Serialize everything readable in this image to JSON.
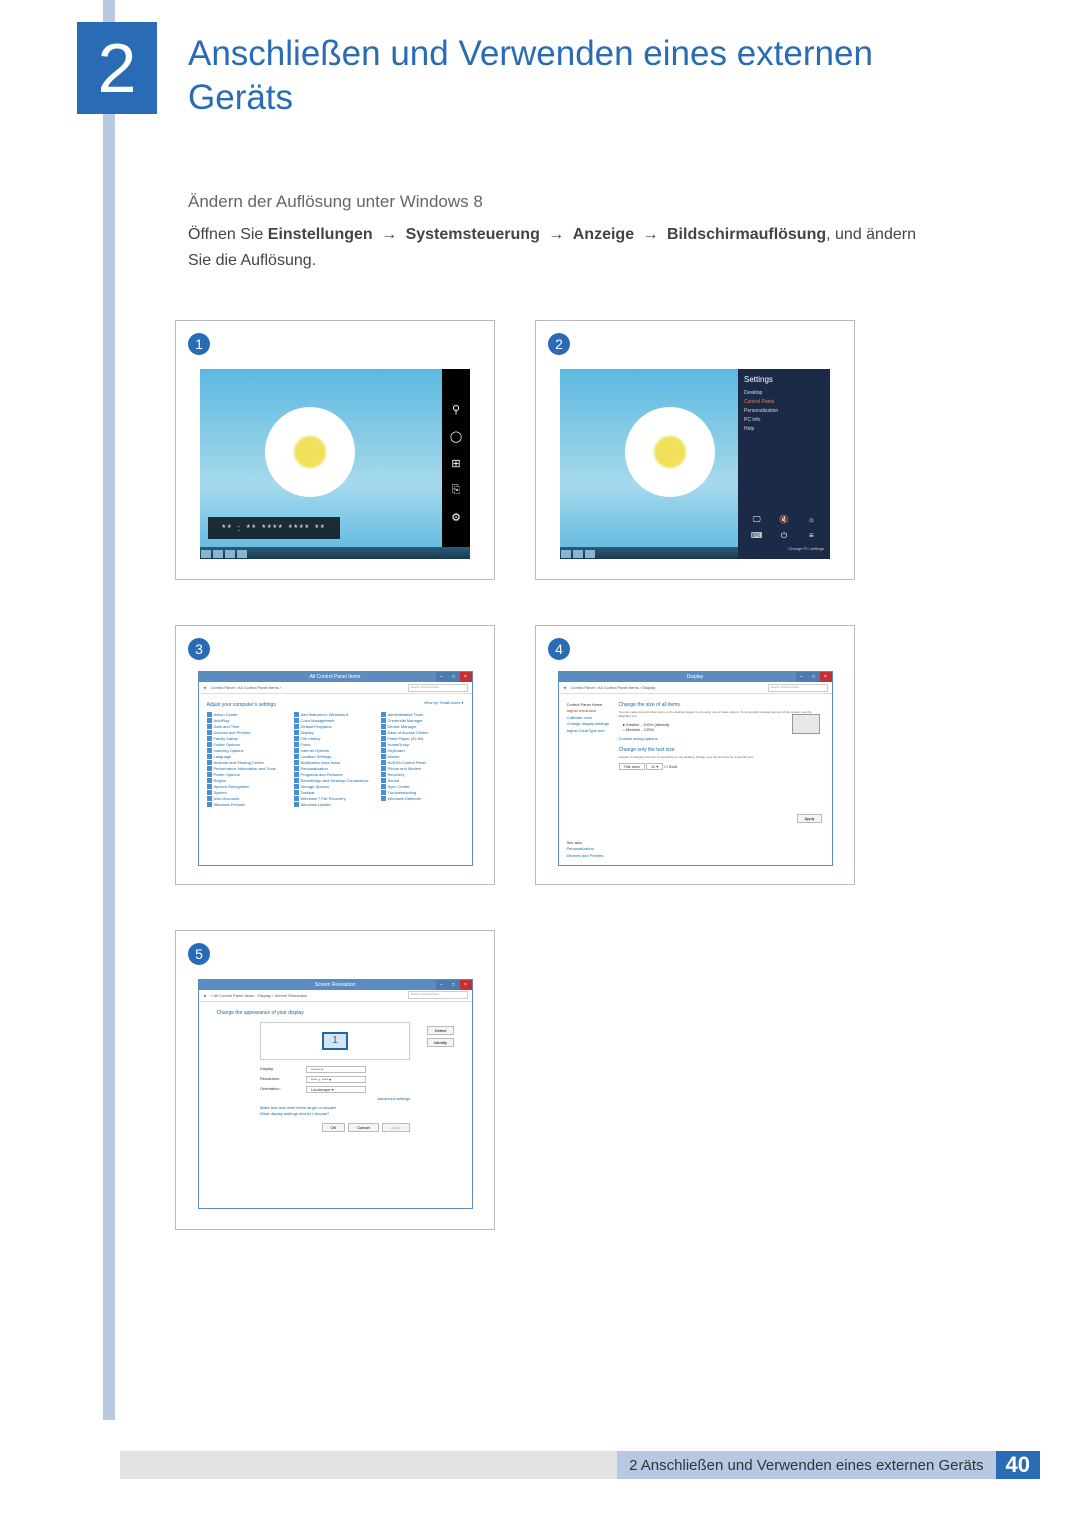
{
  "chapter": {
    "number": "2",
    "title": "Anschließen und Verwenden eines externen Geräts"
  },
  "section_heading": "Ändern der Auflösung unter Windows 8",
  "body": {
    "prefix": "Öffnen Sie ",
    "b1": "Einstellungen",
    "b2": "Systemsteuerung",
    "b3": "Anzeige",
    "b4": "Bildschirmauflösung",
    "suffix": ", und ändern Sie die Auflösung."
  },
  "arrow": "→",
  "figs": [
    "1",
    "2",
    "3",
    "4",
    "5"
  ],
  "charms": {
    "search": "⚲",
    "share": "◯",
    "start": "⊞",
    "devices": "⎘",
    "settings": "⚙"
  },
  "clock": "** : **   ****\n**** **",
  "settings_panel": {
    "title": "Settings",
    "items": [
      "Desktop",
      "Control Panel",
      "Personalization",
      "PC info",
      "Help"
    ],
    "icons": [
      "🖵",
      "🔇",
      "☼",
      "⌨",
      "⏻",
      "≡"
    ],
    "change": "Change PC settings"
  },
  "cp": {
    "title": "All Control Panel Items",
    "path": "Control Panel › All Control Panel Items ›",
    "search": "Search Control Panel",
    "head": "Adjust your computer's settings",
    "viewby": "View by: Small icons ▾",
    "items": [
      "Action Center",
      "Add features to Windows 8",
      "Administrative Tools",
      "AutoPlay",
      "Color Management",
      "Credential Manager",
      "Date and Time",
      "Default Programs",
      "Device Manager",
      "Devices and Printers",
      "Display",
      "Ease of Access Center",
      "Family Safety",
      "File History",
      "Flash Player (32-bit)",
      "Folder Options",
      "Fonts",
      "HomeGroup",
      "Indexing Options",
      "Internet Options",
      "Keyboard",
      "Language",
      "Location Settings",
      "Mouse",
      "Network and Sharing Center",
      "Notification Area Icons",
      "NVIDIA Control Panel",
      "Performance Information and Tools",
      "Personalization",
      "Phone and Modem",
      "Power Options",
      "Programs and Features",
      "Recovery",
      "Region",
      "RemoteApp and Desktop Connections",
      "Sound",
      "Speech Recognition",
      "Storage Spaces",
      "Sync Center",
      "System",
      "Taskbar",
      "Troubleshooting",
      "User Accounts",
      "Windows 7 File Recovery",
      "Windows Defender",
      "Windows Firewall",
      "Windows Update",
      ""
    ]
  },
  "disp": {
    "title": "Display",
    "path": "Control Panel › All Control Panel Items › Display",
    "sidebar": {
      "home": "Control Panel Home",
      "items": [
        "Adjust resolution",
        "Calibrate color",
        "Change display settings",
        "Adjust ClearType text"
      ],
      "seealso_head": "See also",
      "seealso": [
        "Personalization",
        "Devices and Printers"
      ]
    },
    "main": {
      "h1": "Change the size of all items",
      "t1": "You can make text and other items on the desktop bigger by choosing one of these options. To temporarily enlarge just part of the screen, use the Magnifier tool.",
      "r1": "● Smaller - 100% (default)",
      "r2": "○ Medium - 125%",
      "custom": "Custom sizing options",
      "h2": "Change only the text size",
      "t2": "Instead of changing the size of everything on the desktop, change only the text size for a specific item.",
      "dd_label": "Title bars",
      "dd_size": "11 ▾",
      "bold": "☐ Bold",
      "apply": "Apply"
    }
  },
  "res": {
    "title": "Screen Resolution",
    "path": "« All Control Panel Items › Display › Screen Resolution",
    "head": "Change the appearance of your display",
    "detect": "Detect",
    "identify": "Identify",
    "fields": {
      "display_lbl": "Display:",
      "display_val": "********",
      "res_lbl": "Resolution:",
      "res_val": "**** × **** ▾",
      "orient_lbl": "Orientation:",
      "orient_val": "Landscape ▾"
    },
    "adv": "Advanced settings",
    "link1": "Make text and other items larger or smaller",
    "link2": "What display settings should I choose?",
    "ok": "OK",
    "cancel": "Cancel",
    "apply": "Apply"
  },
  "footer": {
    "text": "2 Anschließen und Verwenden eines externen Geräts",
    "page": "40"
  }
}
